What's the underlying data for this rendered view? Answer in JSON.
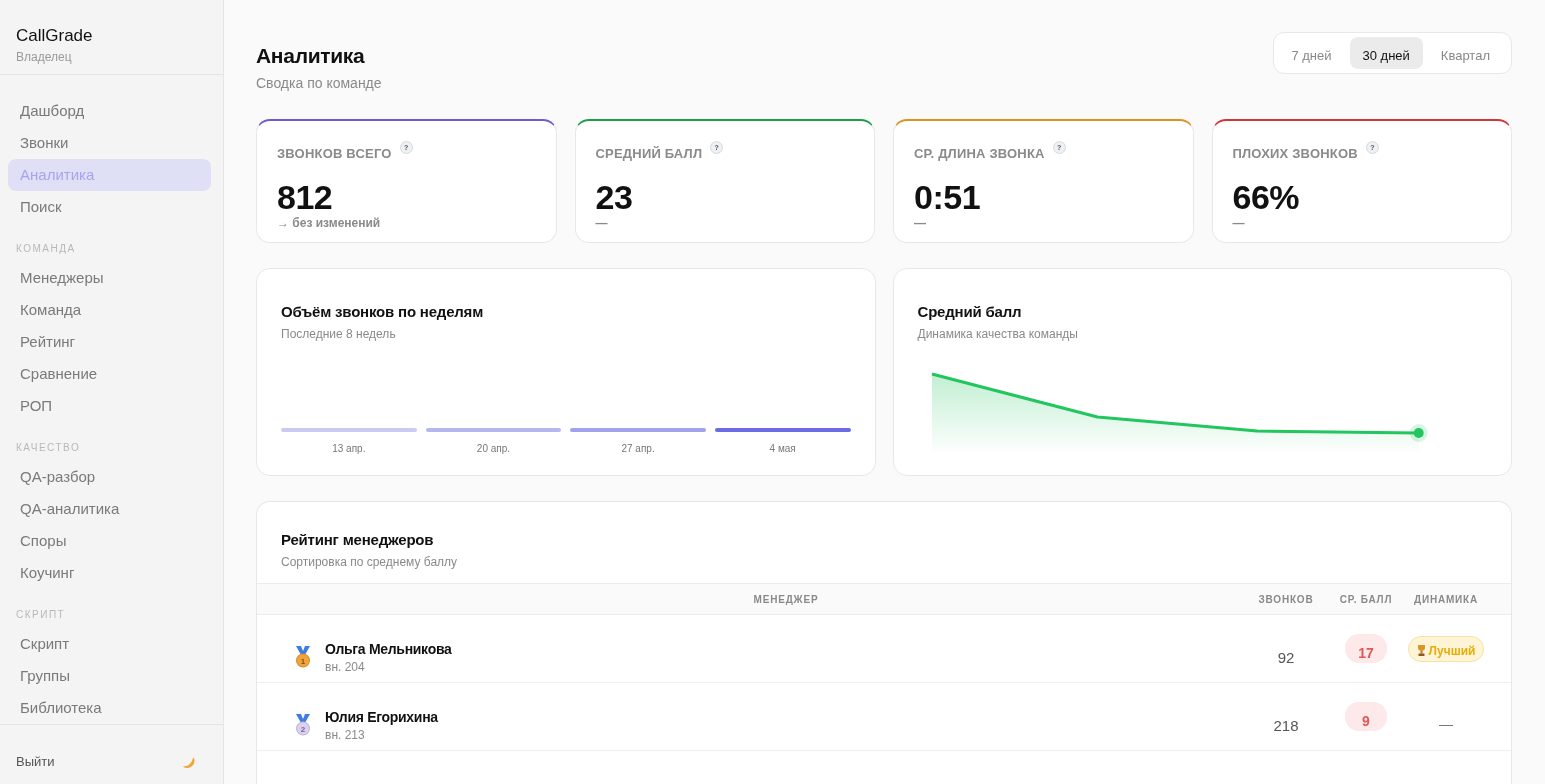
{
  "sidebar": {
    "brand": "CallGrade",
    "role": "Владелец",
    "groups": [
      {
        "items": [
          {
            "label": "Дашборд",
            "selected": false
          },
          {
            "label": "Звонки",
            "selected": false
          },
          {
            "label": "Аналитика",
            "selected": true
          },
          {
            "label": "Поиск",
            "selected": false
          }
        ]
      },
      {
        "title": "КОМАНДА",
        "items": [
          {
            "label": "Менеджеры",
            "selected": false
          },
          {
            "label": "Команда",
            "selected": false
          },
          {
            "label": "Рейтинг",
            "selected": false
          },
          {
            "label": "Сравнение",
            "selected": false
          },
          {
            "label": "РОП",
            "selected": false
          }
        ]
      },
      {
        "title": "КАЧЕСТВО",
        "items": [
          {
            "label": "QA-разбор",
            "selected": false
          },
          {
            "label": "QA-аналитика",
            "selected": false
          },
          {
            "label": "Споры",
            "selected": false
          },
          {
            "label": "Коучинг",
            "selected": false
          }
        ]
      },
      {
        "title": "СКРИПТ",
        "items": [
          {
            "label": "Скрипт",
            "selected": false
          },
          {
            "label": "Группы",
            "selected": false
          },
          {
            "label": "Библиотека",
            "selected": false
          }
        ]
      }
    ],
    "logout": "Выйти"
  },
  "header": {
    "title": "Аналитика",
    "subtitle": "Сводка по команде",
    "periods": [
      {
        "label": "7 дней",
        "selected": false
      },
      {
        "label": "30 дней",
        "selected": true
      },
      {
        "label": "Квартал",
        "selected": false
      }
    ]
  },
  "stats": [
    {
      "label": "ЗВОНКОВ ВСЕГО",
      "hint": "?",
      "value": "812",
      "change": "→ без изменений",
      "color": "#6c5ccf"
    },
    {
      "label": "СРЕДНИЙ БАЛЛ",
      "hint": "?",
      "value": "23",
      "change": "—",
      "color": "#1f9d4c"
    },
    {
      "label": "СР. ДЛИНА ЗВОНКА",
      "hint": "?",
      "value": "0:51",
      "change": "—",
      "color": "#dd9320"
    },
    {
      "label": "ПЛОХИХ ЗВОНКОВ",
      "hint": "?",
      "value": "66%",
      "change": "—",
      "color": "#cf3838"
    }
  ],
  "charts": [
    {
      "kind": "bars",
      "title": "Объём звонков по неделям",
      "subtitle": "Последние 8 недель",
      "bars": [
        {
          "label": "13 апр.",
          "color": "#cacaf3"
        },
        {
          "label": "20 апр.",
          "color": "#b7b7f0"
        },
        {
          "label": "27 апр.",
          "color": "#a1a1ec"
        },
        {
          "label": "4 мая",
          "color": "#6b6be4"
        }
      ]
    },
    {
      "kind": "line",
      "title": "Средний балл",
      "subtitle": "Динамика качества команды"
    }
  ],
  "ranking": {
    "title": "Рейтинг менеджеров",
    "subtitle": "Сортировка по среднему баллу",
    "columns": [
      "МЕНЕДЖЕР",
      "ЗВОНКОВ",
      "СР. БАЛЛ",
      "ДИНАМИКА"
    ],
    "rows": [
      {
        "medal": {
          "rank": "1",
          "color": "#f2a23a"
        },
        "name": "Ольга Мельникова",
        "ext": "вн. 204",
        "calls": "92",
        "score": "17",
        "trend": {
          "kind": "best",
          "label": "Лучший"
        }
      },
      {
        "medal": {
          "rank": "2",
          "color": "#dccff2"
        },
        "name": "Юлия Егорихина",
        "ext": "вн. 213",
        "calls": "218",
        "score": "9",
        "trend": {
          "kind": "none",
          "label": "—"
        }
      }
    ]
  }
}
